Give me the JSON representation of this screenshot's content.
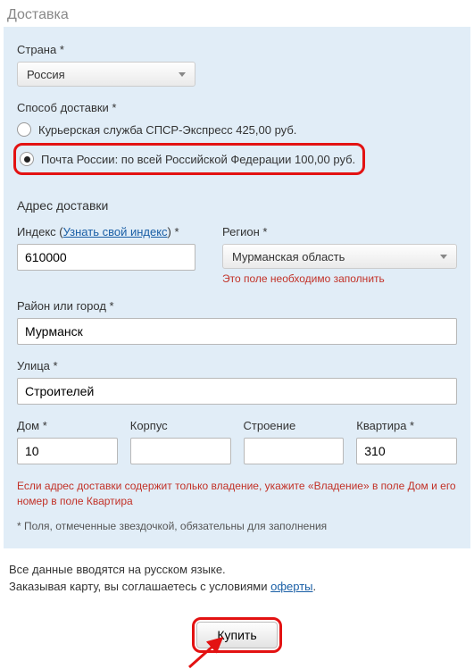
{
  "section_title": "Доставка",
  "country": {
    "label": "Страна *",
    "value": "Россия"
  },
  "shipping": {
    "label": "Способ доставки *",
    "option1": "Курьерская служба СПСР-Экспресс 425,00 руб.",
    "option2": "Почта России: по всей Российской Федерации 100,00 руб."
  },
  "address_heading": "Адрес доставки",
  "index": {
    "label_before": "Индекс (",
    "link": "Узнать свой индекс",
    "label_after": ") *",
    "value": "610000"
  },
  "region": {
    "label": "Регион *",
    "value": "Мурманская область",
    "error": "Это поле необходимо заполнить"
  },
  "city": {
    "label": "Район или город *",
    "value": "Мурманск"
  },
  "street": {
    "label": "Улица *",
    "value": "Строителей"
  },
  "house": {
    "label": "Дом *",
    "value": "10"
  },
  "korpus": {
    "label": "Корпус",
    "value": ""
  },
  "building": {
    "label": "Строение",
    "value": ""
  },
  "apt": {
    "label": "Квартира *",
    "value": "310"
  },
  "note_red": "Если адрес доставки содержит только владение, укажите «Владение» в поле Дом и его номер в поле Квартира",
  "note_gray": "* Поля, отмеченные звездочкой, обязательны для заполнения",
  "footer": {
    "line1": "Все данные вводятся на русском языке.",
    "line2_a": "Заказывая карту, вы соглашаетесь с условиями ",
    "line2_link": "оферты",
    "line2_b": "."
  },
  "buy_label": "Купить"
}
